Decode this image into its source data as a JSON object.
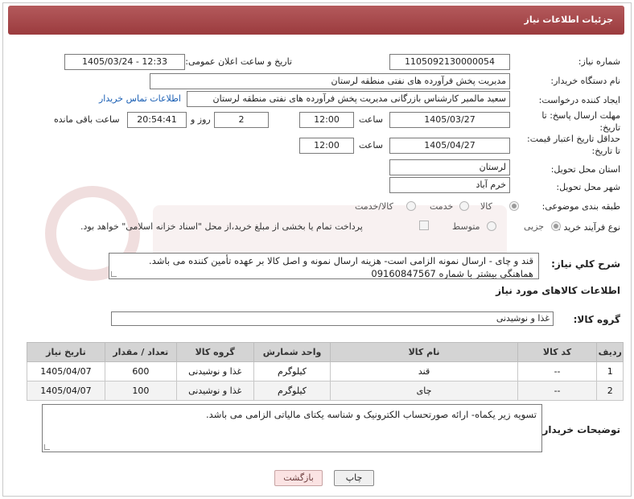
{
  "header": {
    "title": "جزئیات اطلاعات نیاز"
  },
  "fields": {
    "need_number": {
      "label": "شماره نیاز:",
      "value": "1105092130000054"
    },
    "announce_datetime": {
      "label": "تاریخ و ساعت اعلان عمومی:",
      "value": "1405/03/24 - 12:33"
    },
    "buyer_org": {
      "label": "نام دستگاه خریدار:",
      "value": "مدیریت پخش فرآورده های نفتی منطقه لرستان"
    },
    "requester": {
      "label": "ایجاد کننده درخواست:",
      "value": "سعید مالمیر کارشناس بازرگانی مدیریت پخش فرآورده های نفتی منطقه لرستان",
      "contact_link": "اطلاعات تماس خریدار"
    },
    "reply_deadline": {
      "label_line1": "مهلت ارسال پاسخ: تا",
      "label_line2": "تاریخ:",
      "date": "1405/03/27",
      "time_label": "ساعت",
      "time": "12:00",
      "days": "2",
      "days_label": "روز و",
      "remaining": "20:54:41",
      "remaining_label": "ساعت باقی مانده"
    },
    "price_validity": {
      "label_line1": "حداقل تاریخ اعتبار قیمت:",
      "label_line2": "تا تاریخ:",
      "date": "1405/04/27",
      "time_label": "ساعت",
      "time": "12:00"
    },
    "delivery_province": {
      "label": "استان محل تحویل:",
      "value": "لرستان"
    },
    "delivery_city": {
      "label": "شهر محل تحویل:",
      "value": "خرم آباد"
    },
    "category": {
      "label": "طبقه بندی موضوعی:",
      "options": [
        "کالا",
        "خدمت",
        "کالا/خدمت"
      ]
    },
    "process_type": {
      "label": "نوع فرآیند خرید :",
      "options": [
        "جزیی",
        "متوسط"
      ],
      "payment_note": "پرداخت تمام یا بخشی از مبلغ خرید،از محل \"اسناد خزانه اسلامی\" خواهد بود."
    }
  },
  "description": {
    "label": "شرح كلي نياز:",
    "line1": "قند و چای - ارسال نمونه الزامی است- هزینه ارسال نمونه و اصل کالا بر عهده تأمین کننده می باشد.",
    "line2": "هماهنگی بیشتر با شماره 09160847567"
  },
  "goods_section": {
    "title": "اطلاعات کالاهای مورد نیاز",
    "group_label": "گروه کالا:",
    "group_value": "غذا و نوشیدنی"
  },
  "table": {
    "headers": [
      "ردیف",
      "کد کالا",
      "نام کالا",
      "واحد شمارش",
      "گروه کالا",
      "تعداد / مقدار",
      "تاریخ نیاز"
    ],
    "rows": [
      [
        "1",
        "--",
        "قند",
        "کیلوگرم",
        "غذا و نوشیدنی",
        "600",
        "1405/04/07"
      ],
      [
        "2",
        "--",
        "چای",
        "کیلوگرم",
        "غذا و نوشیدنی",
        "100",
        "1405/04/07"
      ]
    ]
  },
  "buyer_notes": {
    "label": "توضیحات خریدار:",
    "text": "تسویه زیر یکماه- ارائه صورتحساب الکترونیک و شناسه یکتای مالیاتی الزامی می باشد."
  },
  "buttons": {
    "print": "چاپ",
    "back": "بازگشت"
  },
  "colors": {
    "header": "#a4474a",
    "link": "#1a5fb4",
    "back_button": "#fbe3e3"
  }
}
